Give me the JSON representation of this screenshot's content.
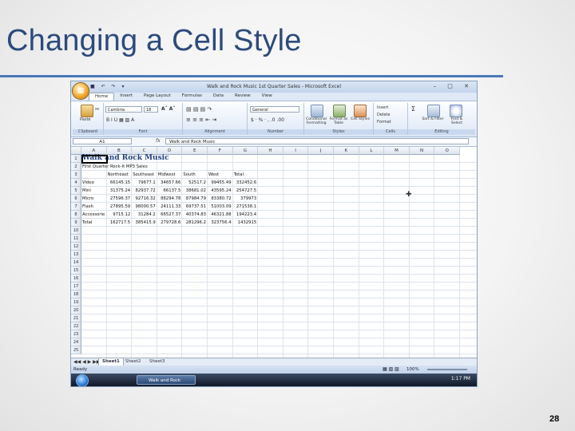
{
  "slide": {
    "title": "Changing a Cell Style",
    "page_number": "28"
  },
  "excel": {
    "window_title": "Walk and Rock Music 1st Quarter Sales - Microsoft Excel",
    "qat": "■ ↶ ↷ ▾",
    "window_controls": "– □ ✕",
    "tabs": [
      "Home",
      "Insert",
      "Page Layout",
      "Formulas",
      "Data",
      "Review",
      "View"
    ],
    "ribbon": {
      "clipboard": {
        "paste": "Paste",
        "label": "Clipboard"
      },
      "font": {
        "name": "Cambria",
        "size": "18",
        "label": "Font",
        "styles": "B  I  U  ▦  ▧  A"
      },
      "alignment": {
        "label": "Alignment"
      },
      "number": {
        "format": "General",
        "symbols": "$ · % · ,  .0  .00",
        "label": "Number"
      },
      "styles": {
        "conditional": "Conditional Formatting",
        "format_table": "Format as Table",
        "cell_styles": "Cell Styles",
        "label": "Styles"
      },
      "cells": {
        "insert": "Insert",
        "delete": "Delete",
        "format": "Format",
        "label": "Cells"
      },
      "editing": {
        "sort": "Sort & Filter",
        "find": "Find & Select",
        "sum": "Σ",
        "label": "Editing"
      }
    },
    "formula_bar": {
      "name_box": "A1",
      "fx": "fx",
      "value": "Walk and Rock Music"
    },
    "columns": [
      "A",
      "B",
      "C",
      "D",
      "E",
      "F",
      "G",
      "H",
      "I",
      "J",
      "K",
      "L",
      "M",
      "N",
      "O"
    ],
    "rows": [
      "1",
      "2",
      "3",
      "4",
      "5",
      "6",
      "7",
      "8",
      "9",
      "10",
      "11",
      "12",
      "13",
      "14",
      "15",
      "16",
      "17",
      "18",
      "19",
      "20",
      "21",
      "22",
      "23",
      "24",
      "25"
    ],
    "cells": {
      "title": "Walk and Rock Music",
      "subtitle": "First Quarter Rock-It MP3 Sales",
      "headers": [
        "Northeast",
        "Southeast",
        "Midwest",
        "South",
        "West",
        "Total"
      ],
      "data": [
        {
          "label": "Video",
          "values": [
            "66145.15",
            "79677.1",
            "34657.66",
            "52517.2",
            "99455.49",
            "332452.6"
          ]
        },
        {
          "label": "Mini",
          "values": [
            "31375.24",
            "82937.72",
            "66137.5",
            "38681.02",
            "43595.24",
            "254727.5"
          ]
        },
        {
          "label": "Micro",
          "values": [
            "27596.37",
            "92716.32",
            "88294.78",
            "87984.79",
            "83380.72",
            "379973"
          ]
        },
        {
          "label": "Flash",
          "values": [
            "27895.59",
            "98000.57",
            "24111.33",
            "69737.51",
            "51003.09",
            "271538.1"
          ]
        },
        {
          "label": "Accessorie",
          "values": [
            "9715.12",
            "31284.2",
            "66527.37",
            "40374.83",
            "46321.88",
            "194223.4"
          ]
        },
        {
          "label": "Total",
          "values": [
            "162717.5",
            "385415.9",
            "279728.6",
            "281296.2",
            "323756.4",
            "1432915"
          ]
        }
      ]
    },
    "sheets": [
      "Sheet1",
      "Sheet2",
      "Sheet3"
    ],
    "status": {
      "ready": "Ready",
      "zoom": "100%"
    },
    "taskbar": {
      "app_button": "Walk and Rock Musi...",
      "clock": "1:17 PM"
    }
  }
}
